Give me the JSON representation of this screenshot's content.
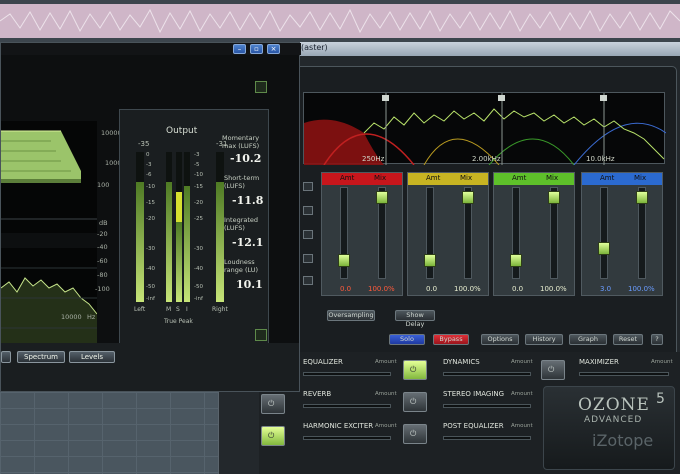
{
  "ozone": {
    "title": "(aster)",
    "spectrum_labels": [
      "250Hz",
      "2.00kHz",
      "10.0kHz"
    ],
    "bands": [
      {
        "amt": "Amt",
        "mix": "Mix",
        "value": "0.0",
        "percent": "100.0%",
        "head_color": "#c8161c",
        "value_color": "#ff5a3c",
        "amt_level": 0.15,
        "mix_level": 0.95
      },
      {
        "amt": "Amt",
        "mix": "Mix",
        "value": "0.0",
        "percent": "100.0%",
        "head_color": "#c8b422",
        "value_color": "#e8eed0",
        "amt_level": 0.15,
        "mix_level": 0.95
      },
      {
        "amt": "Amt",
        "mix": "Mix",
        "value": "0.0",
        "percent": "100.0%",
        "head_color": "#5ec02a",
        "value_color": "#e8eed0",
        "amt_level": 0.15,
        "mix_level": 0.95
      },
      {
        "amt": "Amt",
        "mix": "Mix",
        "value": "3.0",
        "percent": "100.0%",
        "head_color": "#2b6ad0",
        "value_color": "#6a9cff",
        "amt_level": 0.3,
        "mix_level": 0.95
      }
    ],
    "oversampling": "Oversampling",
    "show_delay": "Show Delay",
    "buttons": {
      "solo": "Solo",
      "bypass": "Bypass",
      "options": "Options",
      "history": "History",
      "graph": "Graph",
      "reset": "Reset",
      "help": "?"
    },
    "modules": {
      "equalizer": "EQUALIZER",
      "dynamics": "DYNAMICS",
      "maximizer": "MAXIMIZER",
      "reverb": "REVERB",
      "stereo_imaging": "STEREO IMAGING",
      "harmonic_exciter": "HARMONIC EXCITER",
      "post_equalizer": "POST EQUALIZER",
      "amount": "Amount"
    },
    "logo": {
      "name": "OZONE",
      "version": "5",
      "edition": "ADVANCED",
      "brand": "iZotope"
    },
    "colors": {
      "accent_green": "#b8e26a",
      "bypass_red": "#c41e28",
      "solo_blue": "#2848b8"
    }
  },
  "meter": {
    "title": "Output",
    "peak_left": "-35",
    "peak_right": "-31",
    "scale": [
      "-3",
      "-6",
      "-10",
      "-15",
      "-20",
      "-25",
      "-30",
      "-40",
      "-50",
      "-inf"
    ],
    "scale_right": [
      "-3",
      "-5",
      "-10",
      "-15",
      "-20",
      "-25",
      "-30",
      "-40",
      "-50",
      "-inf"
    ],
    "scale_left_numbers": [
      "0",
      "-3",
      "-6",
      "-10",
      "-15",
      "-20",
      "-30",
      "-40",
      "-50",
      "-inf"
    ],
    "momentary_label": "Momentary max (LUFS)",
    "momentary_value": "-10.2",
    "short_term_label": "Short-term (LUFS)",
    "short_term_value": "-11.8",
    "integrated_label": "Integrated (LUFS)",
    "integrated_value": "-12.1",
    "range_label": "Loudness range (LU)",
    "range_value": "10.1",
    "bottom": {
      "left": "Left",
      "m": "M",
      "s": "S",
      "i": "I",
      "right": "Right",
      "true_peak": "True Peak"
    },
    "spec3d_axis": [
      "10000",
      "1000",
      "100"
    ],
    "spec2d_axis": [
      "dB",
      "-20",
      "-40",
      "-60",
      "-80",
      "-100"
    ],
    "spec2d_x": [
      "10000",
      "Hz"
    ],
    "tabs": {
      "spectrum": "Spectrum",
      "levels": "Levels"
    }
  }
}
